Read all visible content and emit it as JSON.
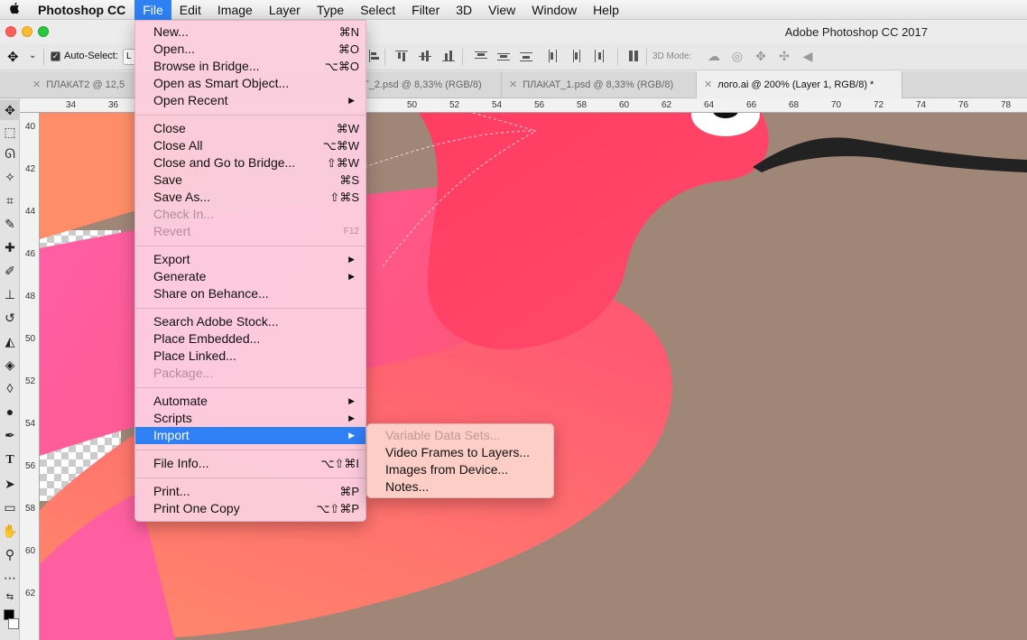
{
  "menubar": {
    "apple": "",
    "app_name": "Photoshop CC",
    "items": [
      "File",
      "Edit",
      "Image",
      "Layer",
      "Type",
      "Select",
      "Filter",
      "3D",
      "View",
      "Window",
      "Help"
    ]
  },
  "window": {
    "title": "Adobe Photoshop CC 2017"
  },
  "options_bar": {
    "auto_select_label": "Auto-Select:",
    "auto_select_value": "L",
    "mode_3d_label": "3D Mode:"
  },
  "tabs": [
    {
      "label": "ПЛАКАТ2 @ 12,5",
      "active": false
    },
    {
      "label": "T_2.psd @ 8,33% (RGB/8)",
      "active": false
    },
    {
      "label": "ПЛАКАТ_1.psd @ 8,33% (RGB/8)",
      "active": false
    },
    {
      "label": "лого.ai @ 200% (Layer 1, RGB/8) *",
      "active": true
    }
  ],
  "ruler_top": [
    "34",
    "36",
    "50",
    "52",
    "54",
    "56",
    "58",
    "60",
    "62",
    "64",
    "66",
    "68",
    "70",
    "72",
    "74",
    "76",
    "78"
  ],
  "ruler_left": [
    "40",
    "42",
    "44",
    "46",
    "48",
    "50",
    "52",
    "54",
    "56",
    "58",
    "60",
    "62"
  ],
  "file_menu": {
    "items": [
      {
        "label": "New...",
        "shortcut": "⌘N"
      },
      {
        "label": "Open...",
        "shortcut": "⌘O"
      },
      {
        "label": "Browse in Bridge...",
        "shortcut": "⌥⌘O"
      },
      {
        "label": "Open as Smart Object...",
        "shortcut": ""
      },
      {
        "label": "Open Recent",
        "shortcut": ""
      },
      {
        "label": "Close",
        "shortcut": "⌘W"
      },
      {
        "label": "Close All",
        "shortcut": "⌥⌘W"
      },
      {
        "label": "Close and Go to Bridge...",
        "shortcut": "⇧⌘W"
      },
      {
        "label": "Save",
        "shortcut": "⌘S"
      },
      {
        "label": "Save As...",
        "shortcut": "⇧⌘S"
      },
      {
        "label": "Check In...",
        "shortcut": ""
      },
      {
        "label": "Revert",
        "shortcut": "F12"
      },
      {
        "label": "Export",
        "shortcut": ""
      },
      {
        "label": "Generate",
        "shortcut": ""
      },
      {
        "label": "Share on Behance...",
        "shortcut": ""
      },
      {
        "label": "Search Adobe Stock...",
        "shortcut": ""
      },
      {
        "label": "Place Embedded...",
        "shortcut": ""
      },
      {
        "label": "Place Linked...",
        "shortcut": ""
      },
      {
        "label": "Package...",
        "shortcut": ""
      },
      {
        "label": "Automate",
        "shortcut": ""
      },
      {
        "label": "Scripts",
        "shortcut": ""
      },
      {
        "label": "Import",
        "shortcut": ""
      },
      {
        "label": "File Info...",
        "shortcut": "⌥⇧⌘I"
      },
      {
        "label": "Print...",
        "shortcut": "⌘P"
      },
      {
        "label": "Print One Copy",
        "shortcut": "⌥⇧⌘P"
      }
    ]
  },
  "import_submenu": {
    "items": [
      {
        "label": "Variable Data Sets..."
      },
      {
        "label": "Video Frames to Layers..."
      },
      {
        "label": "Images from Device..."
      },
      {
        "label": "Notes..."
      }
    ]
  },
  "colors": {
    "menu_highlight": "#2f7ff5",
    "canvas_background": "#a08677",
    "bird_pink": "#ff4f7a",
    "bird_orange": "#ff8a6a"
  }
}
